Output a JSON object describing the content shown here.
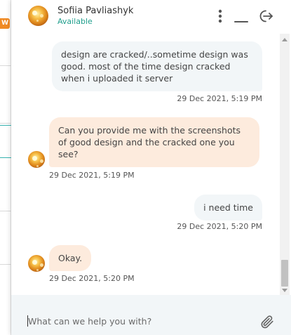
{
  "background": {
    "badge_text": "W"
  },
  "header": {
    "agent_name": "Sofiia Pavliashyk",
    "status": "Available",
    "icons": [
      "more-vertical-icon",
      "minimize-icon",
      "exit-icon"
    ]
  },
  "messages": [
    {
      "from": "user",
      "text": "design are cracked/..sometime design was good. most of the time design cracked when i uploaded it server",
      "time": "29 Dec 2021, 5:19 PM"
    },
    {
      "from": "agent",
      "text": "Can you provide me with the screenshots of good design and the cracked one you see?",
      "time": "29 Dec 2021, 5:19 PM"
    },
    {
      "from": "user",
      "text": "i need time",
      "time": "29 Dec 2021, 5:20 PM"
    },
    {
      "from": "agent",
      "text": "Okay.",
      "time": "29 Dec 2021, 5:20 PM"
    }
  ],
  "composer": {
    "placeholder": "What can we help you with?",
    "value": "",
    "attach_icon": "paperclip-icon"
  },
  "colors": {
    "status_green": "#1f9e8c",
    "user_bubble": "#f2f6f8",
    "agent_bubble": "#fdebdd",
    "composer_bg": "#f2f6f8",
    "badge_orange": "#f08a24",
    "accent_teal": "#37b3b0"
  }
}
